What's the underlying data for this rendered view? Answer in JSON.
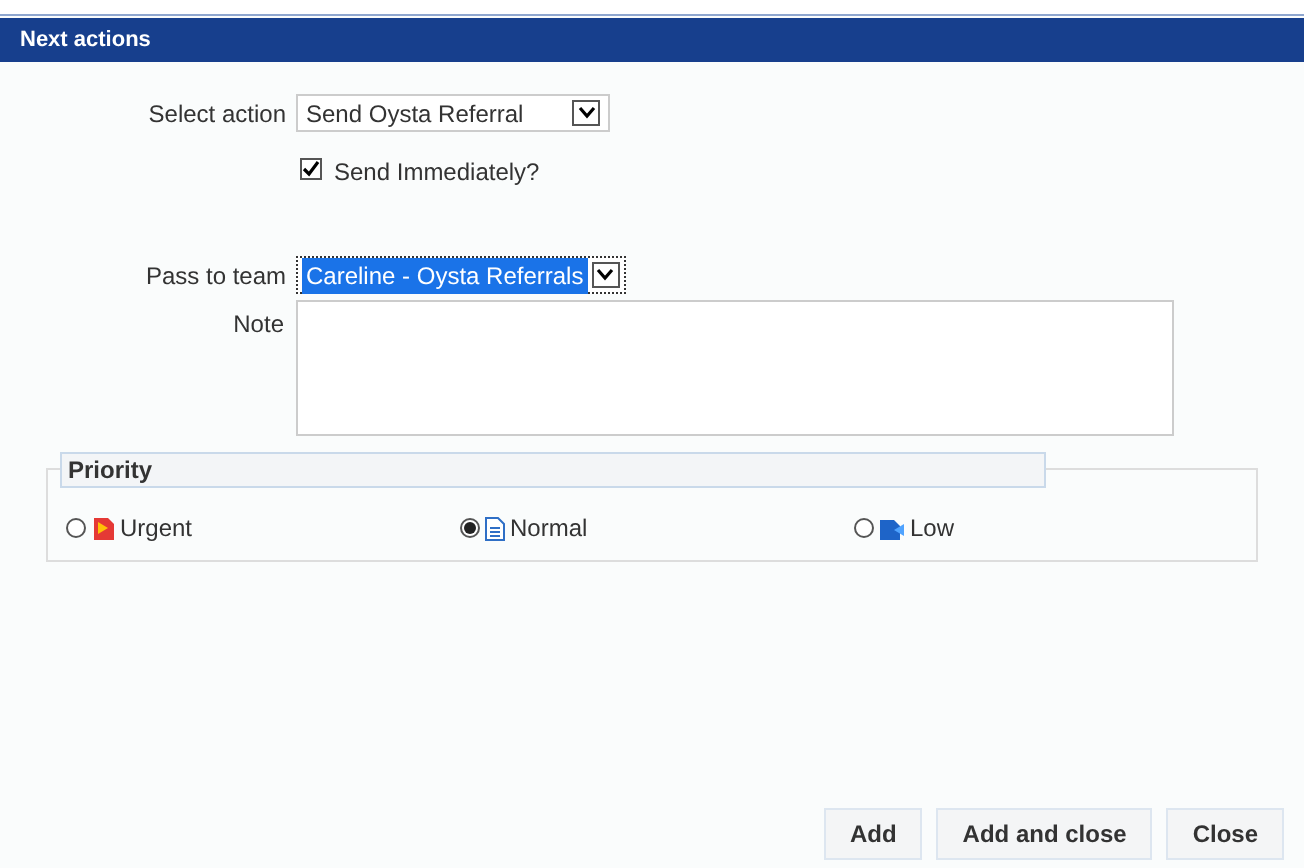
{
  "header": {
    "title": "Next actions"
  },
  "action": {
    "label": "Select action",
    "value": "Send Oysta Referral"
  },
  "send_immediately": {
    "label": "Send Immediately?",
    "checked": true
  },
  "team": {
    "label": "Pass to team",
    "value": "Careline - Oysta Referrals",
    "selected": true
  },
  "note": {
    "label": "Note"
  },
  "priority": {
    "legend": "Priority",
    "options": [
      {
        "label": "Urgent",
        "kind": "urgent",
        "selected": false
      },
      {
        "label": "Normal",
        "kind": "normal",
        "selected": true
      },
      {
        "label": "Low",
        "kind": "low",
        "selected": false
      }
    ]
  },
  "buttons": [
    "Add",
    "Add and close",
    "Close"
  ]
}
